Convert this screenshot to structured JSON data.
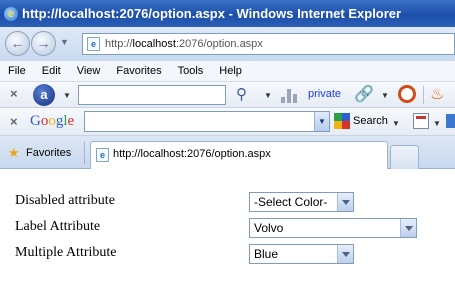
{
  "window": {
    "title": "http://localhost:2076/option.aspx - Windows Internet Explorer"
  },
  "address_bar": {
    "url_prefix": "http://",
    "url_host": "localhost",
    "url_rest": ":2076/option.aspx"
  },
  "menu": {
    "items": [
      "File",
      "Edit",
      "View",
      "Favorites",
      "Tools",
      "Help"
    ]
  },
  "ask_toolbar": {
    "private_label": "private"
  },
  "google_toolbar": {
    "search_label": "Search"
  },
  "tabs": {
    "favorites_label": "Favorites",
    "active_tab_title": "http://localhost:2076/option.aspx"
  },
  "form": {
    "disabled_label": "Disabled attribute",
    "disabled_select_value": "-Select Color-",
    "label_label": "Label Attribute",
    "label_select_value": "Volvo",
    "multiple_label": "Multiple Attribute",
    "multiple_select_value": "Blue"
  }
}
